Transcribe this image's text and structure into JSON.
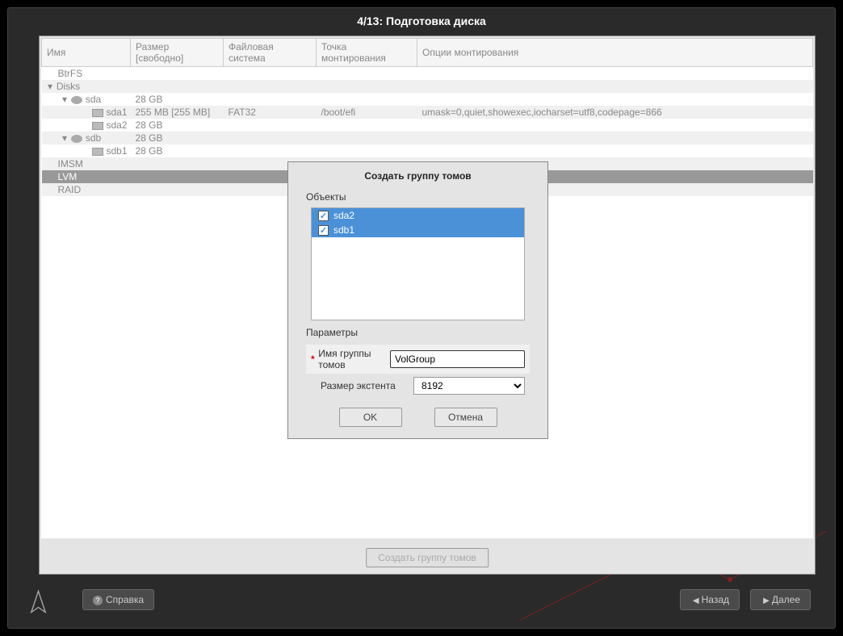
{
  "header": {
    "title": "4/13: Подготовка диска"
  },
  "table": {
    "headers": {
      "name": "Имя",
      "size": "Размер [свободно]",
      "fs": "Файловая система",
      "mount": "Точка монтирования",
      "opts": "Опции монтирования"
    },
    "rows": {
      "btrfs": "BtrFS",
      "disks": "Disks",
      "sda": "sda",
      "sda_size": "28 GB",
      "sda1": "sda1",
      "sda1_size": "255 MB [255 MB]",
      "sda1_fs": "FAT32",
      "sda1_mount": "/boot/efi",
      "sda1_opts": "umask=0,quiet,showexec,iocharset=utf8,codepage=866",
      "sda2": "sda2",
      "sda2_size": "28 GB",
      "sdb": "sdb",
      "sdb_size": "28 GB",
      "sdb1": "sdb1",
      "sdb1_size": "28 GB",
      "imsm": "IMSM",
      "lvm": "LVM",
      "raid": "RAID"
    }
  },
  "bottom_button": "Создать группу томов",
  "dialog": {
    "title": "Создать группу томов",
    "objects_label": "Объекты",
    "items": {
      "i0": "sda2",
      "i1": "sdb1"
    },
    "params_label": "Параметры",
    "name_label": "Имя группы томов",
    "name_value": "VolGroup",
    "extent_label": "Размер экстента",
    "extent_value": "8192",
    "ok": "OK",
    "cancel": "Отмена"
  },
  "footer": {
    "help": "Справка",
    "back": "Назад",
    "next": "Далее"
  }
}
